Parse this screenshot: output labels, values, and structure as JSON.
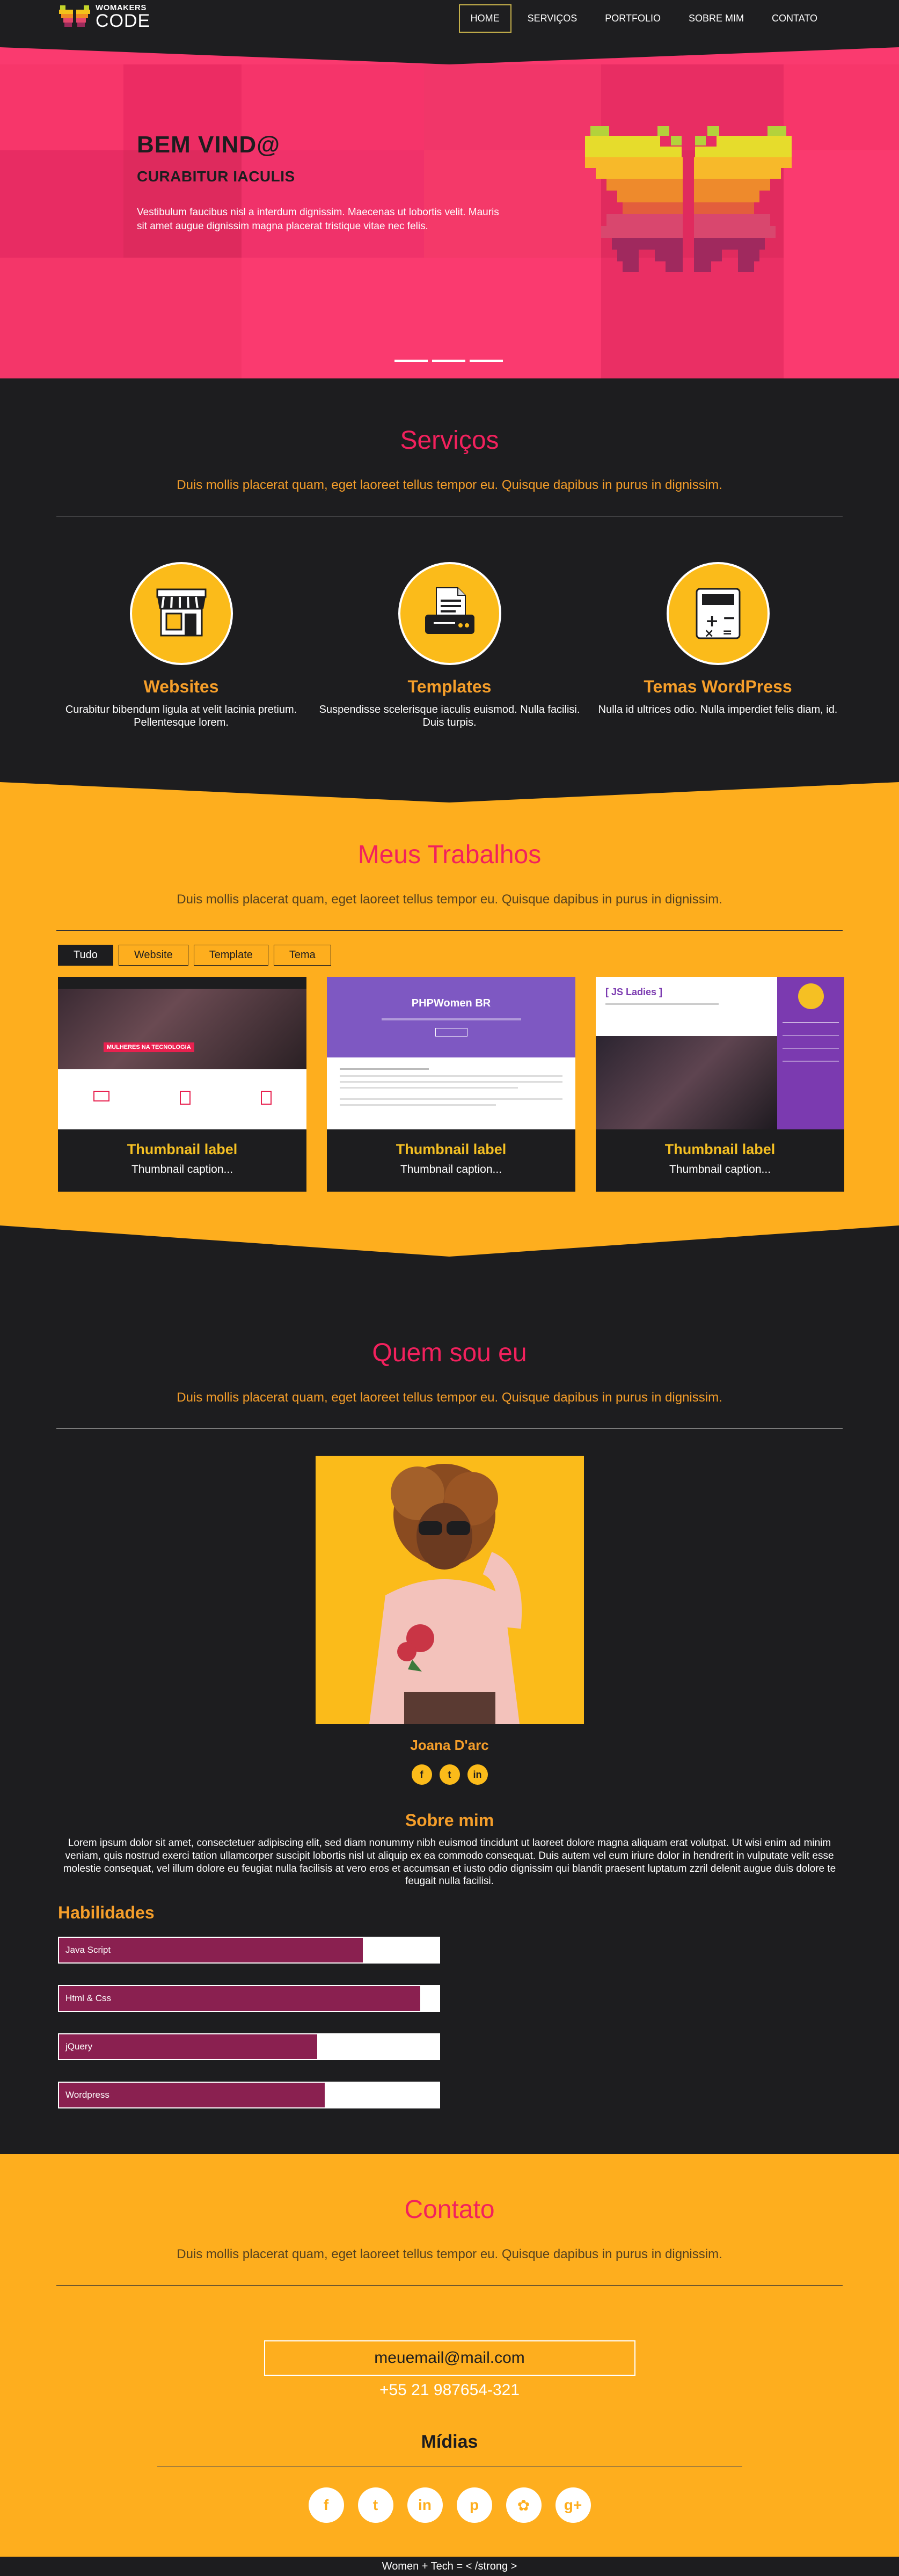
{
  "brand": {
    "top": "WOMAKERS",
    "bottom": "CODE"
  },
  "nav": [
    {
      "label": "HOME",
      "active": true
    },
    {
      "label": "SERVIÇOS"
    },
    {
      "label": "PORTFOLIO"
    },
    {
      "label": "SOBRE MIM"
    },
    {
      "label": "CONTATO"
    }
  ],
  "hero": {
    "title": "BEM VIND@",
    "subtitle": "CURABITUR IACULIS",
    "description": "Vestibulum faucibus nisl a interdum dignissim. Maecenas ut lobortis velit. Mauris sit amet augue dignissim magna placerat tristique vitae nec felis."
  },
  "services": {
    "title": "Serviços",
    "subtitle": "Duis mollis placerat quam, eget laoreet tellus tempor eu. Quisque dapibus in purus in dignissim.",
    "items": [
      {
        "title": "Websites",
        "desc": "Curabitur bibendum ligula at velit lacinia pretium. Pellentesque lorem."
      },
      {
        "title": "Templates",
        "desc": "Suspendisse scelerisque iaculis euismod. Nulla facilisi. Duis turpis."
      },
      {
        "title": "Temas WordPress",
        "desc": "Nulla id ultrices odio. Nulla imperdiet felis diam, id."
      }
    ]
  },
  "portfolio": {
    "title": "Meus Trabalhos",
    "subtitle": "Duis mollis placerat quam, eget laoreet tellus tempor eu. Quisque dapibus in purus in dignissim.",
    "filters": [
      "Tudo",
      "Website",
      "Template",
      "Tema"
    ],
    "thumbs": [
      {
        "label": "Thumbnail label",
        "caption": "Thumbnail caption...",
        "inner": "MULHERES NA TECNOLOGIA"
      },
      {
        "label": "Thumbnail label",
        "caption": "Thumbnail caption...",
        "inner": "PHPWomen BR"
      },
      {
        "label": "Thumbnail label",
        "caption": "Thumbnail caption...",
        "inner": "[ JS Ladies ]"
      }
    ]
  },
  "about": {
    "title": "Quem sou eu",
    "subtitle": "Duis mollis placerat quam, eget laoreet tellus tempor eu. Quisque dapibus in purus in dignissim.",
    "name": "Joana D'arc",
    "socials": [
      "f",
      "t",
      "in"
    ],
    "about_title": "Sobre mim",
    "about_text": "Lorem ipsum dolor sit amet, consectetuer adipiscing elit, sed diam nonummy nibh euismod tincidunt ut laoreet dolore magna aliquam erat volutpat. Ut wisi enim ad minim veniam, quis nostrud exerci tation ullamcorper suscipit lobortis nisl ut aliquip ex ea commodo consequat. Duis autem vel eum iriure dolor in hendrerit in vulputate velit esse molestie consequat, vel illum dolore eu feugiat nulla facilisis at vero eros et accumsan et iusto odio dignissim qui blandit praesent luptatum zzril delenit augue duis dolore te feugait nulla facilisi.",
    "skills_title": "Habilidades",
    "skills": [
      {
        "name": "Java Script",
        "level": 0.8
      },
      {
        "name": "Html & Css",
        "level": 0.95
      },
      {
        "name": "jQuery",
        "level": 0.68
      },
      {
        "name": "Wordpress",
        "level": 0.7
      }
    ]
  },
  "contact": {
    "title": "Contato",
    "subtitle": "Duis mollis placerat quam, eget laoreet tellus tempor eu. Quisque dapibus in purus in dignissim.",
    "email": "meuemail@mail.com",
    "phone": "+55 21 987654-321",
    "midias_title": "Mídias",
    "midias": [
      "f",
      "t",
      "in",
      "p",
      "✿",
      "g+"
    ]
  },
  "footer": "Women + Tech = < /strong >",
  "colors": {
    "pink": "#fa3a6f",
    "accent": "#f2215d",
    "yellow": "#feae1e",
    "dark": "#1d1d1f",
    "orange": "#f59e2a"
  }
}
